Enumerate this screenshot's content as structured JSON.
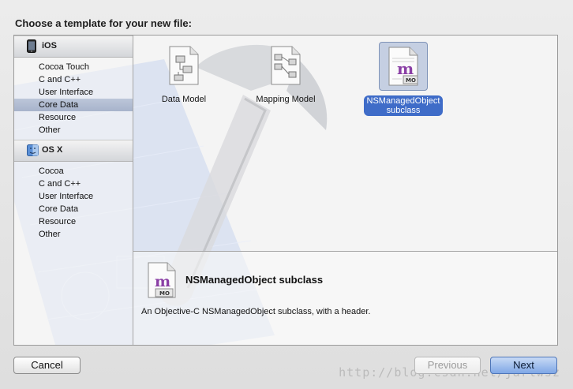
{
  "title": "Choose a template for your new file:",
  "sidebar": {
    "sections": [
      {
        "header": "iOS",
        "icon": "iphone-icon",
        "items": [
          "Cocoa Touch",
          "C and C++",
          "User Interface",
          "Core Data",
          "Resource",
          "Other"
        ],
        "selected": "Core Data"
      },
      {
        "header": "OS X",
        "icon": "finder-icon",
        "items": [
          "Cocoa",
          "C and C++",
          "User Interface",
          "Core Data",
          "Resource",
          "Other"
        ]
      }
    ]
  },
  "templates": [
    {
      "label": "Data Model",
      "icon": "data-model-icon"
    },
    {
      "label": "Mapping Model",
      "icon": "mapping-model-icon"
    },
    {
      "label_line1": "NSManagedObject",
      "label_line2": "subclass",
      "icon": "managed-object-icon",
      "selected": true
    }
  ],
  "detail": {
    "name": "NSManagedObject subclass",
    "description": "An Objective-C NSManagedObject subclass, with a header."
  },
  "icon_text": {
    "m": "m",
    "mo": "MO"
  },
  "buttons": {
    "cancel": "Cancel",
    "previous": "Previous",
    "next": "Next"
  },
  "watermark": "http://blog.csdn.net/jarlwsz",
  "colors": {
    "selection": "#3f6cc8",
    "sidebar_selected": "#b2bdd3",
    "default_button": "#7fa7e6"
  }
}
